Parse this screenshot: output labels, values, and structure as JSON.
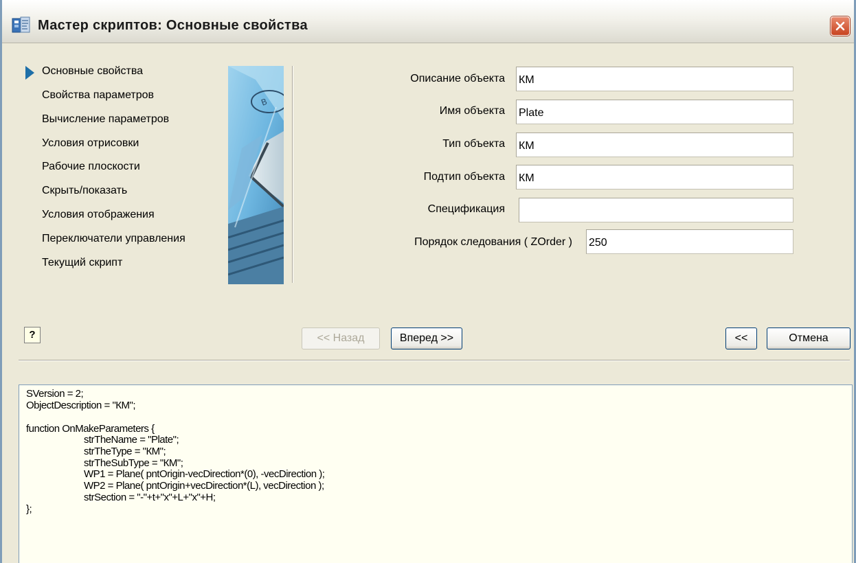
{
  "window": {
    "title": "Мастер скриптов:  Основные свойства",
    "app_icon": "wizard-app-icon",
    "close_icon": "close-icon"
  },
  "steps": {
    "active_index": 0,
    "items": [
      "Основные свойства",
      "Свойства параметров",
      "Вычисление параметров",
      "Условия отрисовки",
      "Рабочие плоскости",
      "Скрыть/показать",
      "Условия отображения",
      "Переключатели управления",
      "Текущий скрипт"
    ]
  },
  "form": {
    "description": {
      "label": "Описание объекта",
      "value": "КМ"
    },
    "name": {
      "label": "Имя объекта",
      "value": "Plate"
    },
    "type": {
      "label": "Тип объекта",
      "value": "КМ"
    },
    "subtype": {
      "label": "Подтип объекта",
      "value": "КМ"
    },
    "specification": {
      "label": "Спецификация",
      "value": ""
    },
    "zorder": {
      "label": "Порядок следования ( ZOrder )",
      "value": "250"
    }
  },
  "buttons": {
    "help": "?",
    "back": "<< Назад",
    "next": "Вперед >>",
    "collapse": "<<",
    "cancel": "Отмена"
  },
  "code": {
    "lines": [
      "SVersion = 2;",
      "ObjectDescription = \"КМ\";",
      "",
      "function OnMakeParameters {",
      "strTheName = \"Plate\";",
      "strTheType = \"КМ\";",
      "strTheSubType = \"КМ\";",
      "WP1 = Plane( pntOrigin-vecDirection*(0), -vecDirection );",
      "WP2 = Plane( pntOrigin+vecDirection*(L), vecDirection );",
      "strSection = \"-\"+t+\"x\"+L+\"x\"+H;",
      "};"
    ]
  },
  "colors": {
    "accent": "#1E6FA8",
    "close_button": "#C8431F",
    "code_background": "#FFFFF2",
    "dialog_background": "#ECE9D8"
  }
}
